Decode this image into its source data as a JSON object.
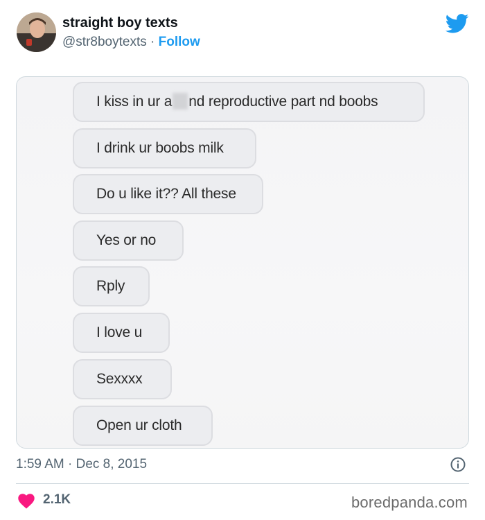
{
  "tweet": {
    "display_name": "straight boy texts",
    "handle": "@str8boytexts",
    "separator": "·",
    "follow_label": "Follow",
    "brand_icon": "twitter-bird-icon",
    "accent_color": "#1d9bf0"
  },
  "messages": [
    {
      "before": "I kiss in ur a",
      "after": "nd reproductive part nd boobs",
      "censored": true
    },
    {
      "text": "I drink ur boobs milk"
    },
    {
      "text": "Do u like it?? All these"
    },
    {
      "text": "Yes or no"
    },
    {
      "text": "Rply"
    },
    {
      "text": "I love u"
    },
    {
      "text": "Sexxxx"
    },
    {
      "text": "Open ur cloth"
    }
  ],
  "footer": {
    "timestamp": "1:59 AM · Dec 8, 2015",
    "info_icon": "info-icon",
    "likes": "2.1K",
    "like_icon": "heart-icon",
    "like_color": "#f91880",
    "watermark": "boredpanda.com"
  }
}
